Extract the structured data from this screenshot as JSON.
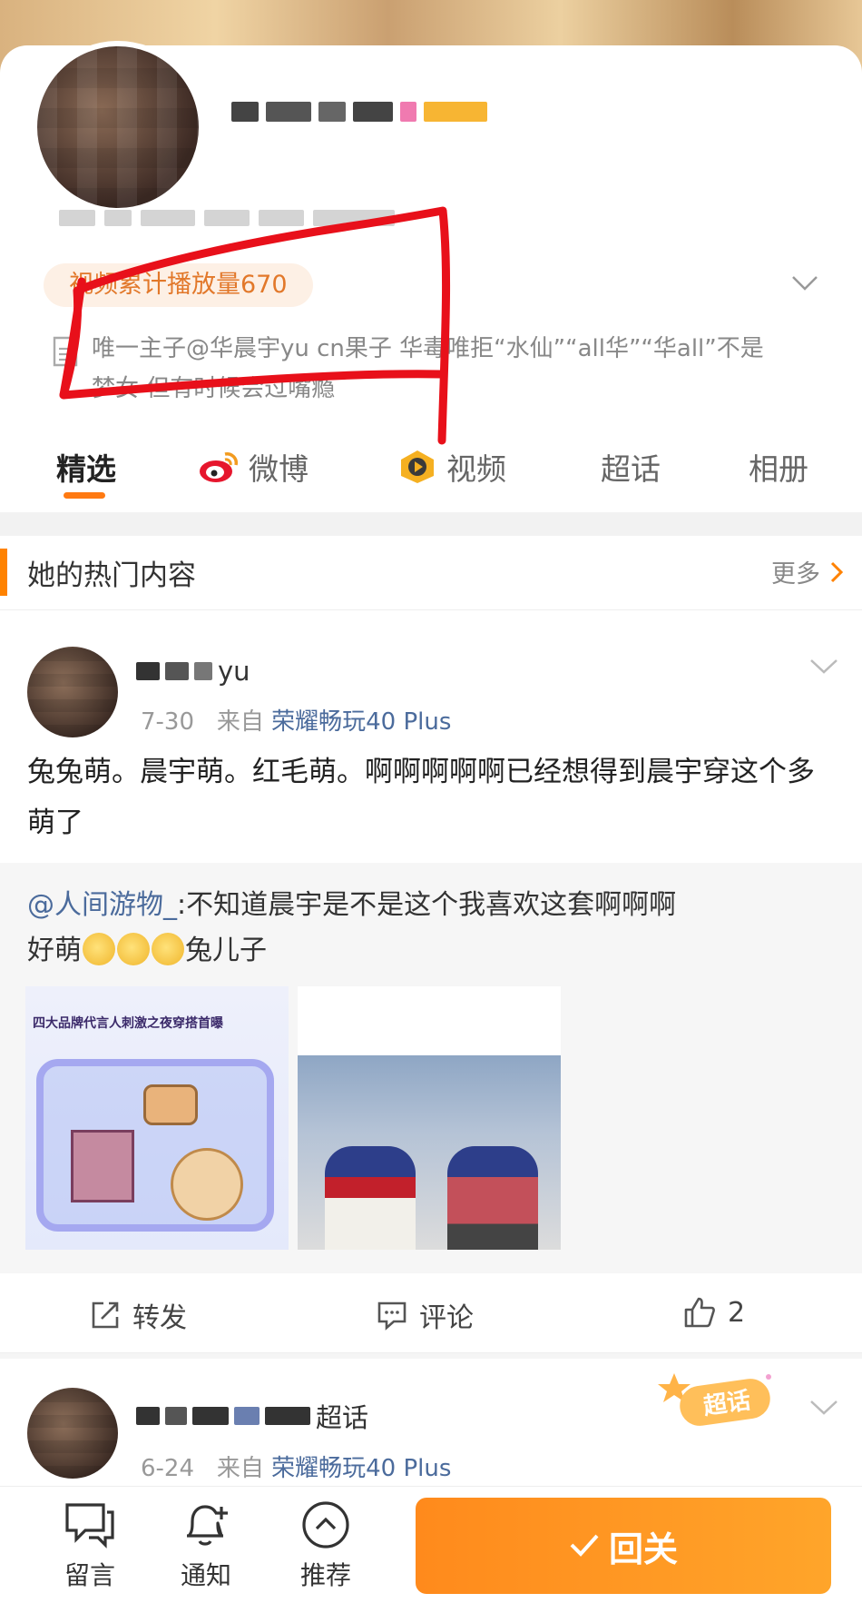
{
  "profile": {
    "play_count_label": "视频累计播放量670",
    "description": "唯一主子@华晨宇yu cn果子 华毒唯拒“水仙”“all华”“华all”不是梦女 但有时候会过嘴瘾"
  },
  "tabs": [
    {
      "label": "精选",
      "icon": null
    },
    {
      "label": "微博",
      "icon": "weibo-icon"
    },
    {
      "label": "视频",
      "icon": "video-icon"
    },
    {
      "label": "超话",
      "icon": null
    },
    {
      "label": "相册",
      "icon": null
    }
  ],
  "section": {
    "title": "她的热门内容",
    "more_label": "更多"
  },
  "post1": {
    "name_visible": "yu",
    "date": "7-30",
    "from_label": "来自",
    "source": "荣耀畅玩40 Plus",
    "text": "兔兔萌。晨宇萌。红毛萌。啊啊啊啊啊已经想得到晨宇穿这个多萌了",
    "repost_at": "@人间游物_",
    "repost_text_a": ":不知道晨宇是不是这个我喜欢这套啊啊啊",
    "repost_text_b": "好萌",
    "repost_text_c": "兔儿子",
    "image1_caption": "四大品牌代言人刺激之夜穿搭首曝",
    "repost_label": "转发",
    "comment_label": "评论",
    "like_count": "2"
  },
  "post2": {
    "name_visible": "超话",
    "date": "6-24",
    "from_label": "来自",
    "source": "荣耀畅玩40 Plus",
    "badge": "超话"
  },
  "bottom_bar": {
    "message_label": "留言",
    "notify_label": "通知",
    "recommend_label": "推荐",
    "follow_label": "回关"
  },
  "colors": {
    "accent": "#ff8200",
    "link": "#4b6b9c",
    "annotation": "#e8101a"
  }
}
